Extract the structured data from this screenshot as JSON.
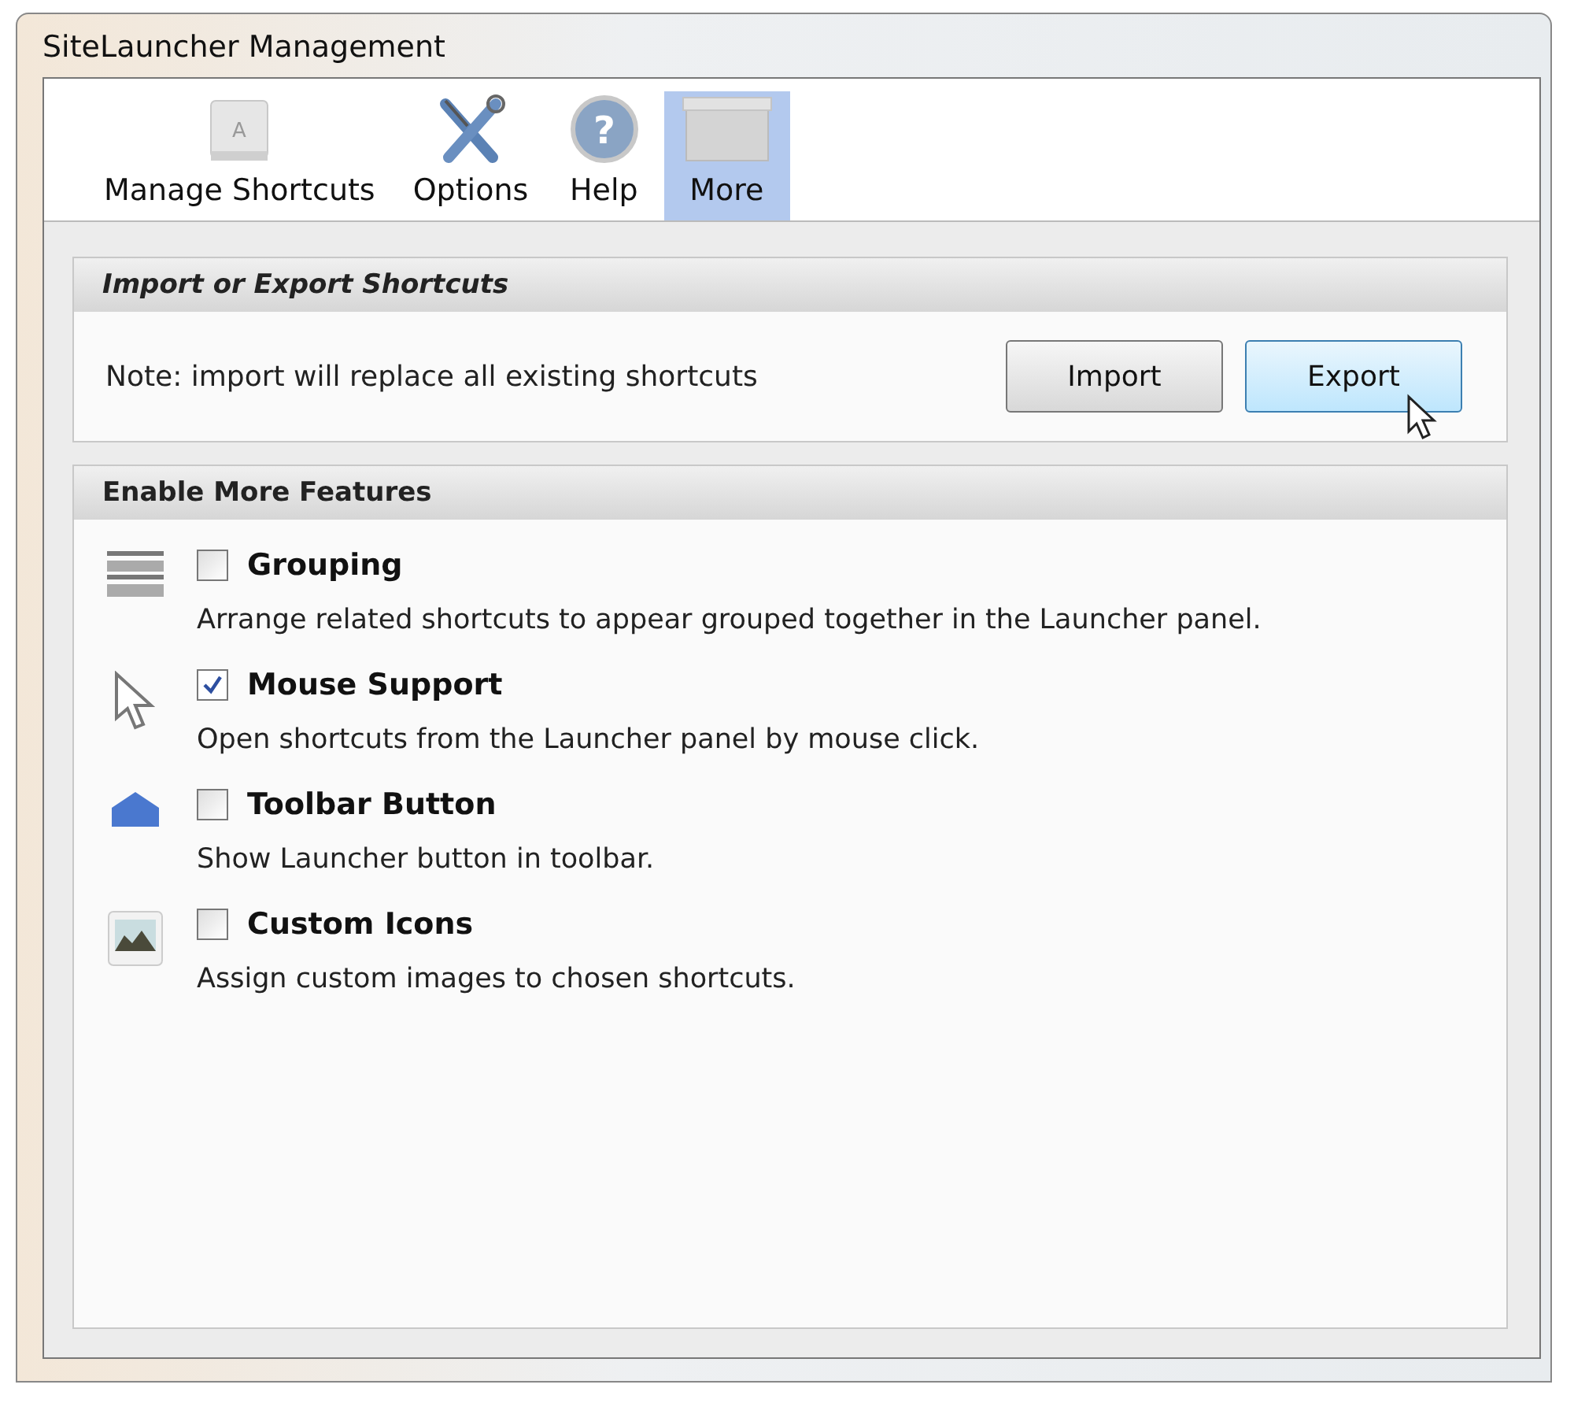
{
  "window": {
    "title": "SiteLauncher Management"
  },
  "tabs": [
    {
      "label": "Manage Shortcuts",
      "kind": "key",
      "icon_text": "A",
      "selected": false
    },
    {
      "label": "Options",
      "kind": "tools",
      "selected": false
    },
    {
      "label": "Help",
      "kind": "help",
      "icon_text": "?",
      "selected": false
    },
    {
      "label": "More",
      "kind": "box",
      "selected": true
    }
  ],
  "import_export": {
    "title": "Import or Export Shortcuts",
    "note": "Note: import will replace all existing shortcuts",
    "buttons": [
      {
        "label": "Import",
        "selected": false
      },
      {
        "label": "Export",
        "selected": true
      }
    ]
  },
  "features": {
    "title": "Enable More Features",
    "items": [
      {
        "kind": "grid",
        "label": "Grouping",
        "checked": false,
        "description": "Arrange related shortcuts to appear grouped together in the Launcher panel."
      },
      {
        "kind": "pointer",
        "label": "Mouse Support",
        "checked": true,
        "description": "Open shortcuts from the Launcher panel by mouse click."
      },
      {
        "kind": "house",
        "label": "Toolbar Button",
        "checked": false,
        "description": "Show Launcher button in toolbar."
      },
      {
        "kind": "picture",
        "label": "Custom Icons",
        "checked": false,
        "description": "Assign custom images to chosen shortcuts."
      }
    ]
  }
}
